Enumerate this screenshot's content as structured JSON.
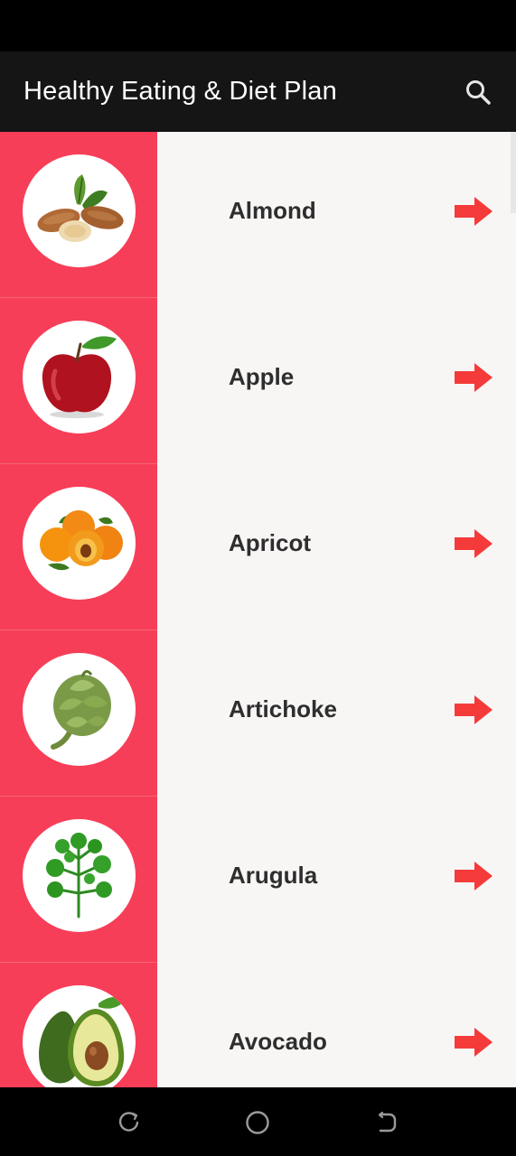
{
  "app": {
    "title": "Healthy Eating & Diet Plan"
  },
  "colors": {
    "accent": "#f73e58",
    "arrow": "#f53a3a",
    "app_bar": "#151515",
    "list_bg": "#f8f6f5"
  },
  "icons": {
    "search": "search-icon",
    "row_arrow": "arrow-right-icon",
    "nav_recent": "recent-apps-icon",
    "nav_home": "home-circle-icon",
    "nav_back": "back-icon"
  },
  "foods": [
    {
      "label": "Almond",
      "image": "almond-image"
    },
    {
      "label": "Apple",
      "image": "apple-image"
    },
    {
      "label": "Apricot",
      "image": "apricot-image"
    },
    {
      "label": "Artichoke",
      "image": "artichoke-image"
    },
    {
      "label": "Arugula",
      "image": "arugula-image"
    },
    {
      "label": "Avocado",
      "image": "avocado-image"
    }
  ]
}
